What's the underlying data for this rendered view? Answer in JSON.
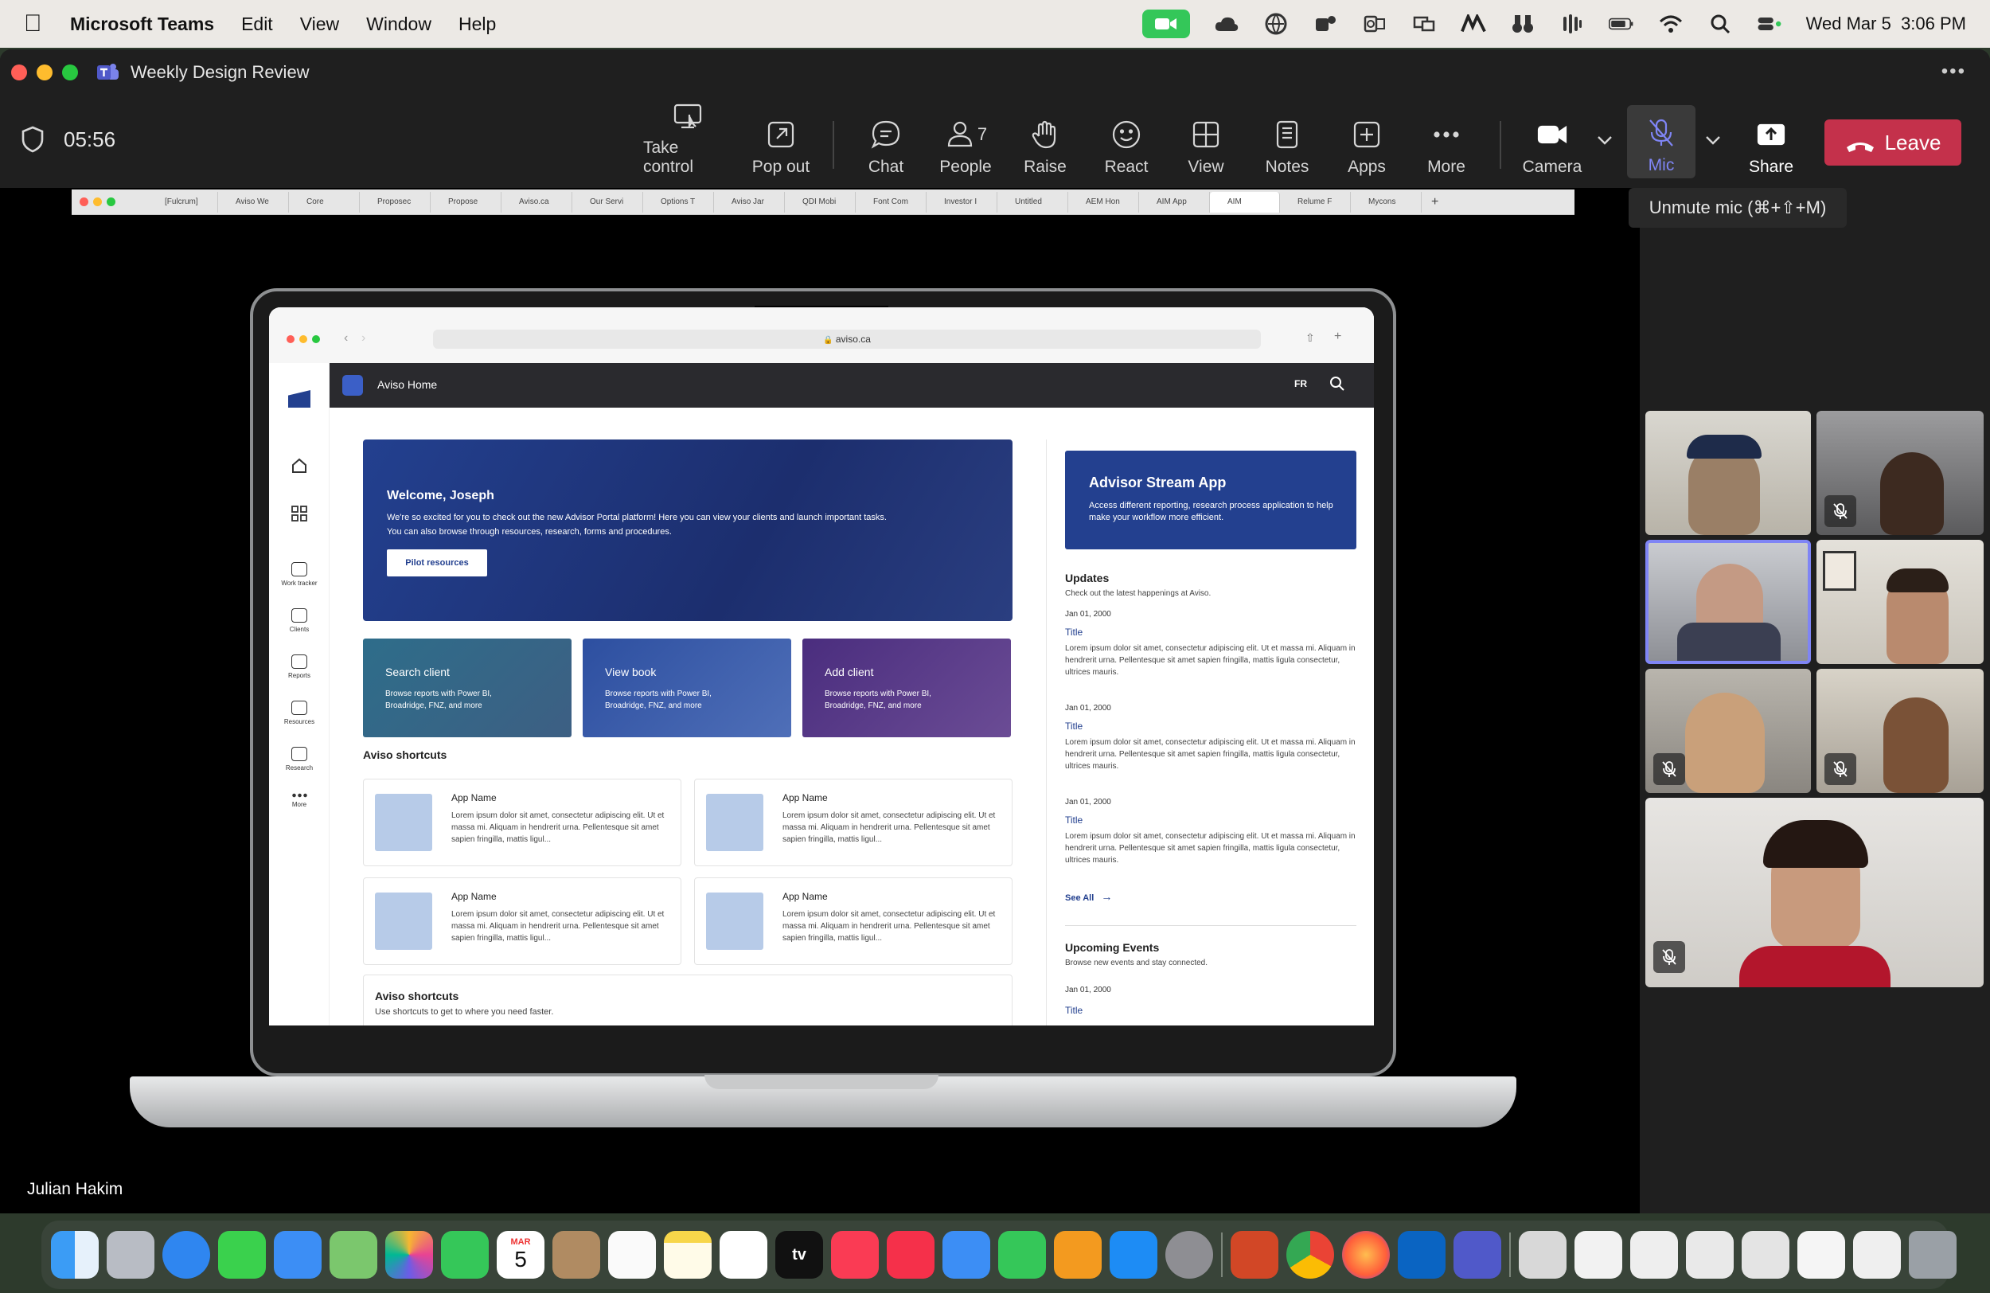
{
  "menubar": {
    "app_name": "Microsoft Teams",
    "items": [
      "Edit",
      "View",
      "Window",
      "Help"
    ],
    "clock": "Wed Mar 5  3:06 PM"
  },
  "window": {
    "title": "Weekly Design Review"
  },
  "meeting": {
    "timer": "05:56",
    "people_count": "7",
    "tooltip": "Unmute mic (⌘+⇧+M)",
    "presenter_name": "Julian Hakim"
  },
  "toolbar": {
    "take_control": "Take control",
    "pop_out": "Pop out",
    "chat": "Chat",
    "people": "People",
    "raise": "Raise",
    "react": "React",
    "view": "View",
    "notes": "Notes",
    "apps": "Apps",
    "more": "More",
    "camera": "Camera",
    "mic": "Mic",
    "share": "Share",
    "leave": "Leave"
  },
  "browser_tabs": [
    "[Fulcrum]",
    "Aviso We",
    "Core",
    "Proposec",
    "Propose",
    "Aviso.ca",
    "Our Servi",
    "Options T",
    "Aviso Jar",
    "QDI Mobi",
    "Font Com",
    "Investor I",
    "Untitled",
    "AEM Hon",
    "AIM App",
    "AIM",
    "Relume F",
    "Mycons"
  ],
  "shared_site": {
    "url": "aviso.ca",
    "header_title": "Aviso Home",
    "lang": "FR",
    "nav": [
      "Work tracker",
      "Clients",
      "Reports",
      "Resources",
      "Research",
      "More"
    ],
    "hero_title": "Welcome, Joseph",
    "hero_text_1": "We're so excited for you to check out the new Advisor Portal platform! Here you can view your clients and launch important tasks.",
    "hero_text_2": "You can also browse through resources, research, forms and procedures.",
    "hero_button": "Pilot resources",
    "cards": [
      {
        "title": "Search client",
        "text": "Browse reports with Power BI, Broadridge, FNZ, and more"
      },
      {
        "title": "View book",
        "text": "Browse reports with Power BI, Broadridge, FNZ, and more"
      },
      {
        "title": "Add client",
        "text": "Browse reports with Power BI, Broadridge, FNZ, and more"
      }
    ],
    "shortcuts_title": "Aviso shortcuts",
    "apps": [
      {
        "name": "App Name",
        "text": "Lorem ipsum dolor sit amet, consectetur adipiscing elit. Ut et massa mi. Aliquam in hendrerit urna. Pellentesque sit amet sapien fringilla, mattis ligul..."
      },
      {
        "name": "App Name",
        "text": "Lorem ipsum dolor sit amet, consectetur adipiscing elit. Ut et massa mi. Aliquam in hendrerit urna. Pellentesque sit amet sapien fringilla, mattis ligul..."
      },
      {
        "name": "App Name",
        "text": "Lorem ipsum dolor sit amet, consectetur adipiscing elit. Ut et massa mi. Aliquam in hendrerit urna. Pellentesque sit amet sapien fringilla, mattis ligul..."
      },
      {
        "name": "App Name",
        "text": "Lorem ipsum dolor sit amet, consectetur adipiscing elit. Ut et massa mi. Aliquam in hendrerit urna. Pellentesque sit amet sapien fringilla, mattis ligul..."
      }
    ],
    "shortcuts2_title": "Aviso shortcuts",
    "shortcuts2_sub": "Use shortcuts to get to where you need faster.",
    "stream_title": "Advisor Stream App",
    "stream_text": "Access different reporting, research process application to help make your workflow more efficient.",
    "updates_title": "Updates",
    "updates_sub": "Check out the latest happenings at Aviso.",
    "updates": [
      {
        "date": "Jan 01, 2000",
        "title": "Title",
        "text": "Lorem ipsum dolor sit amet, consectetur adipiscing elit. Ut et massa mi. Aliquam in hendrerit urna. Pellentesque sit amet sapien fringilla, mattis ligula consectetur, ultrices mauris."
      },
      {
        "date": "Jan 01, 2000",
        "title": "Title",
        "text": "Lorem ipsum dolor sit amet, consectetur adipiscing elit. Ut et massa mi. Aliquam in hendrerit urna. Pellentesque sit amet sapien fringilla, mattis ligula consectetur, ultrices mauris."
      },
      {
        "date": "Jan 01, 2000",
        "title": "Title",
        "text": "Lorem ipsum dolor sit amet, consectetur adipiscing elit. Ut et massa mi. Aliquam in hendrerit urna. Pellentesque sit amet sapien fringilla, mattis ligula consectetur, ultrices mauris."
      }
    ],
    "see_all": "See All",
    "events_title": "Upcoming Events",
    "events_sub": "Browse new events and stay connected.",
    "event_date": "Jan 01, 2000",
    "event_title": "Title"
  },
  "dock": {
    "calendar_month": "MAR",
    "calendar_day": "5",
    "tv_label": "tv"
  },
  "colors": {
    "leave": "#c4314b",
    "accent": "#7f85f5",
    "aviso_blue": "#23408f"
  }
}
